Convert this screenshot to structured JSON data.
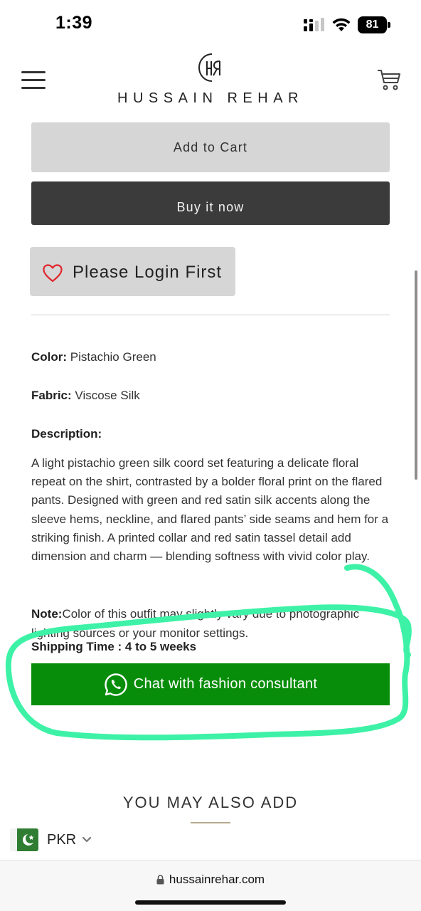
{
  "status_bar": {
    "time": "1:39",
    "battery": "81"
  },
  "header": {
    "brand": "HUSSAIN REHAR"
  },
  "buttons": {
    "add_to_cart": "Add to Cart",
    "buy_now": "Buy it now",
    "wishlist": "Please Login First",
    "chat": "Chat with fashion consultant"
  },
  "details": {
    "color_label": "Color:",
    "color_value": "Pistachio Green",
    "fabric_label": "Fabric:",
    "fabric_value": "Viscose Silk",
    "description_label": "Description:",
    "description_text": "A light pistachio green silk coord set featuring a delicate floral repeat on the shirt, contrasted by a bolder floral print on the flared pants. Designed with green and red satin silk accents along the sleeve hems, neckline, and flared pants’ side seams and hem for a striking finish. A printed collar and red satin tassel detail add dimension and charm — blending softness with vivid color play.",
    "note_label": "Note:",
    "note_text": "Color of this outfit may slightly vary due to photographic lighting sources or your monitor settings.",
    "shipping": "Shipping Time : 4 to 5 weeks"
  },
  "recommendations": {
    "title": "YOU MAY ALSO ADD"
  },
  "currency": {
    "code": "PKR"
  },
  "browser": {
    "url": "hussainrehar.com"
  },
  "colors": {
    "chat_green": "#078d0a",
    "highlight": "#3df2a6",
    "dark_button": "#3b3b3b",
    "light_button": "#d6d6d6",
    "heart_red": "#e0262c"
  }
}
